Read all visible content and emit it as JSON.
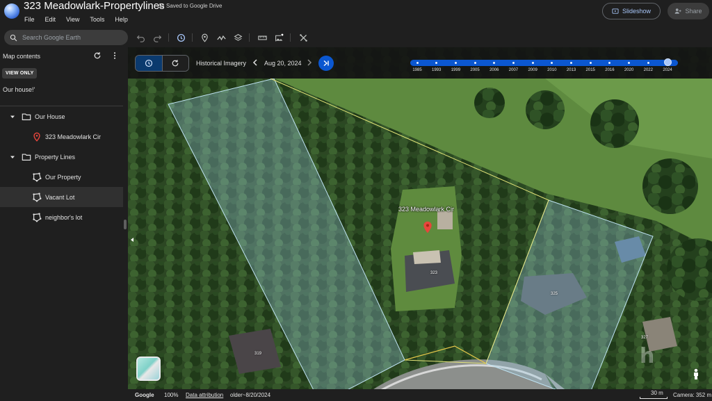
{
  "app": {
    "title": "323 Meadowlark-Propertylines",
    "saved_status": "Saved to Google Drive",
    "menu": [
      "File",
      "Edit",
      "View",
      "Tools",
      "Help"
    ],
    "slideshow_label": "Slideshow",
    "share_label": "Share"
  },
  "toolbar": {
    "search_placeholder": "Search Google Earth",
    "tools": [
      "undo-icon",
      "redo-icon",
      "historical-imagery-icon",
      "placemark-icon",
      "path-icon",
      "layers-icon",
      "measure-icon",
      "image-overlay-icon",
      "tools-icon"
    ]
  },
  "sidebar": {
    "title": "Map contents",
    "view_only_badge": "VIEW ONLY",
    "description": "Our house!'",
    "items": [
      {
        "label": "Our House",
        "type": "folder",
        "level": 0,
        "expanded": true
      },
      {
        "label": "323 Meadowlark Cir",
        "type": "placemark",
        "level": 1
      },
      {
        "label": "Property Lines",
        "type": "folder",
        "level": 0,
        "expanded": true
      },
      {
        "label": "Our Property",
        "type": "polygon",
        "level": 1
      },
      {
        "label": "Vacant Lot",
        "type": "polygon",
        "level": 1,
        "selected": true
      },
      {
        "label": "neighbor's lot",
        "type": "polygon",
        "level": 1
      }
    ]
  },
  "timebar": {
    "label": "Historical Imagery",
    "date": "Aug 20, 2024",
    "years": [
      "1985",
      "1993",
      "1999",
      "2005",
      "2006",
      "2007",
      "2009",
      "2010",
      "2013",
      "2015",
      "2016",
      "2020",
      "2022",
      "2024"
    ],
    "selected_year": "2024"
  },
  "map": {
    "placemark_label": "323 Meadowlark Cir",
    "house_numbers": [
      "323",
      "325",
      "319",
      "327"
    ],
    "watermark": "h"
  },
  "status_bar": {
    "brand": "Google",
    "zoom": "100%",
    "attribution_link": "Data attribution",
    "imagery_date": "older~8/20/2024",
    "scale": "30 m",
    "camera": "Camera: 352 m"
  },
  "colors": {
    "accent": "#0b57d0",
    "accent_light": "#a8c7fa",
    "background": "#1f1f1f",
    "polygon_fill": "#9ecfe8",
    "boundary_line": "#e6e67a"
  }
}
